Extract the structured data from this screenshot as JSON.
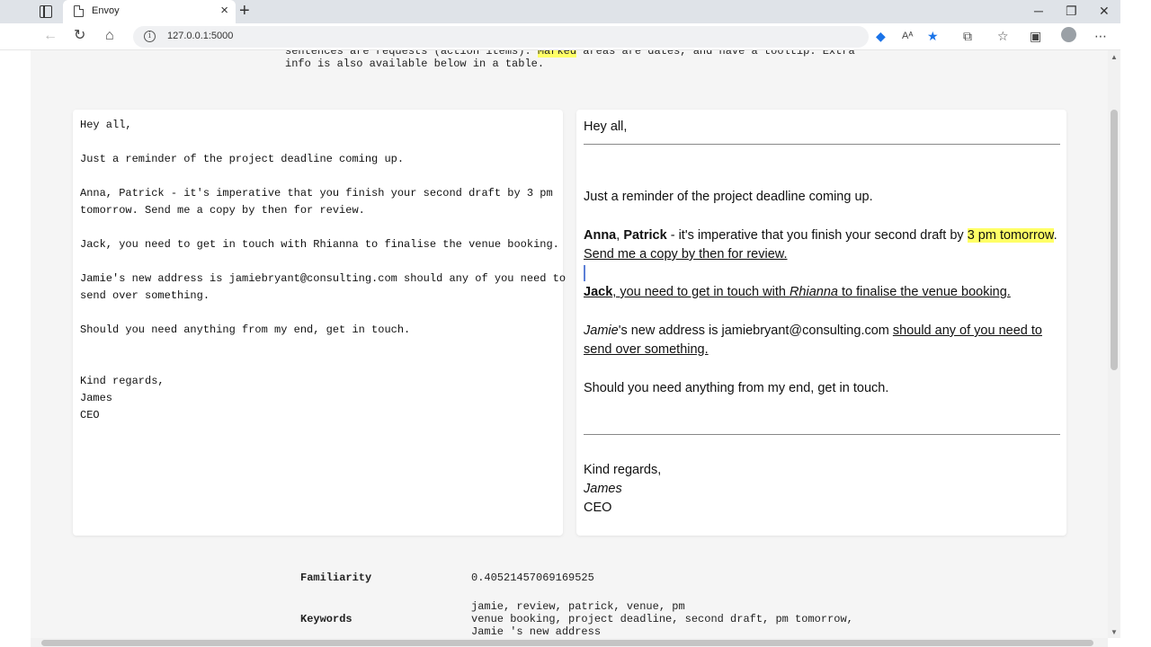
{
  "browser": {
    "tab_title": "Envoy",
    "url": "127.0.0.1:5000"
  },
  "intro": {
    "line1_a": "sentences are requests (action items). ",
    "line1_mark": "Marked",
    "line1_b": " areas are dates, and have a tooltip. Extra",
    "line2": "info is also available below in a table."
  },
  "raw_email": "Hey all,\n\nJust a reminder of the project deadline coming up.\n\nAnna, Patrick - it's imperative that you finish your second draft by 3 pm\ntomorrow. Send me a copy by then for review.\n\nJack, you need to get in touch with Rhianna to finalise the venue booking.\n\nJamie's new address is jamiebryant@consulting.com should any of you need to\nsend over something.\n\nShould you need anything from my end, get in touch.\n\n\nKind regards,\nJames\nCEO",
  "rendered": {
    "greeting": "Hey all,",
    "reminder": "Just a reminder of the project deadline coming up.",
    "p1_name1": "Anna",
    "p1_comma": ", ",
    "p1_name2": "Patrick",
    "p1_text": " - it's imperative that you finish your second draft by ",
    "p1_date": "3 pm tomorrow",
    "p1_end": ".",
    "p1_request": "Send me a copy by then for review.",
    "p2_name": "Jack",
    "p2_text1": ", you need to get in touch with ",
    "p2_name2": "Rhianna",
    "p2_text2": " to finalise the venue booking.",
    "p3_name": "Jamie",
    "p3_text": "'s new address is jamiebryant@consulting.com ",
    "p3_request": "should any of you need to send over something.",
    "closing_line": "Should you need anything from my end, get in touch.",
    "signoff": "Kind regards,",
    "sender": "James",
    "title": "CEO"
  },
  "meta": {
    "familiarity_label": "Familiarity",
    "familiarity_value": "0.40521457069169525",
    "keywords_label": "Keywords",
    "keywords_value": "jamie, review, patrick, venue, pm\nvenue booking, project deadline, second draft, pm tomorrow,\nJamie 's new address"
  }
}
